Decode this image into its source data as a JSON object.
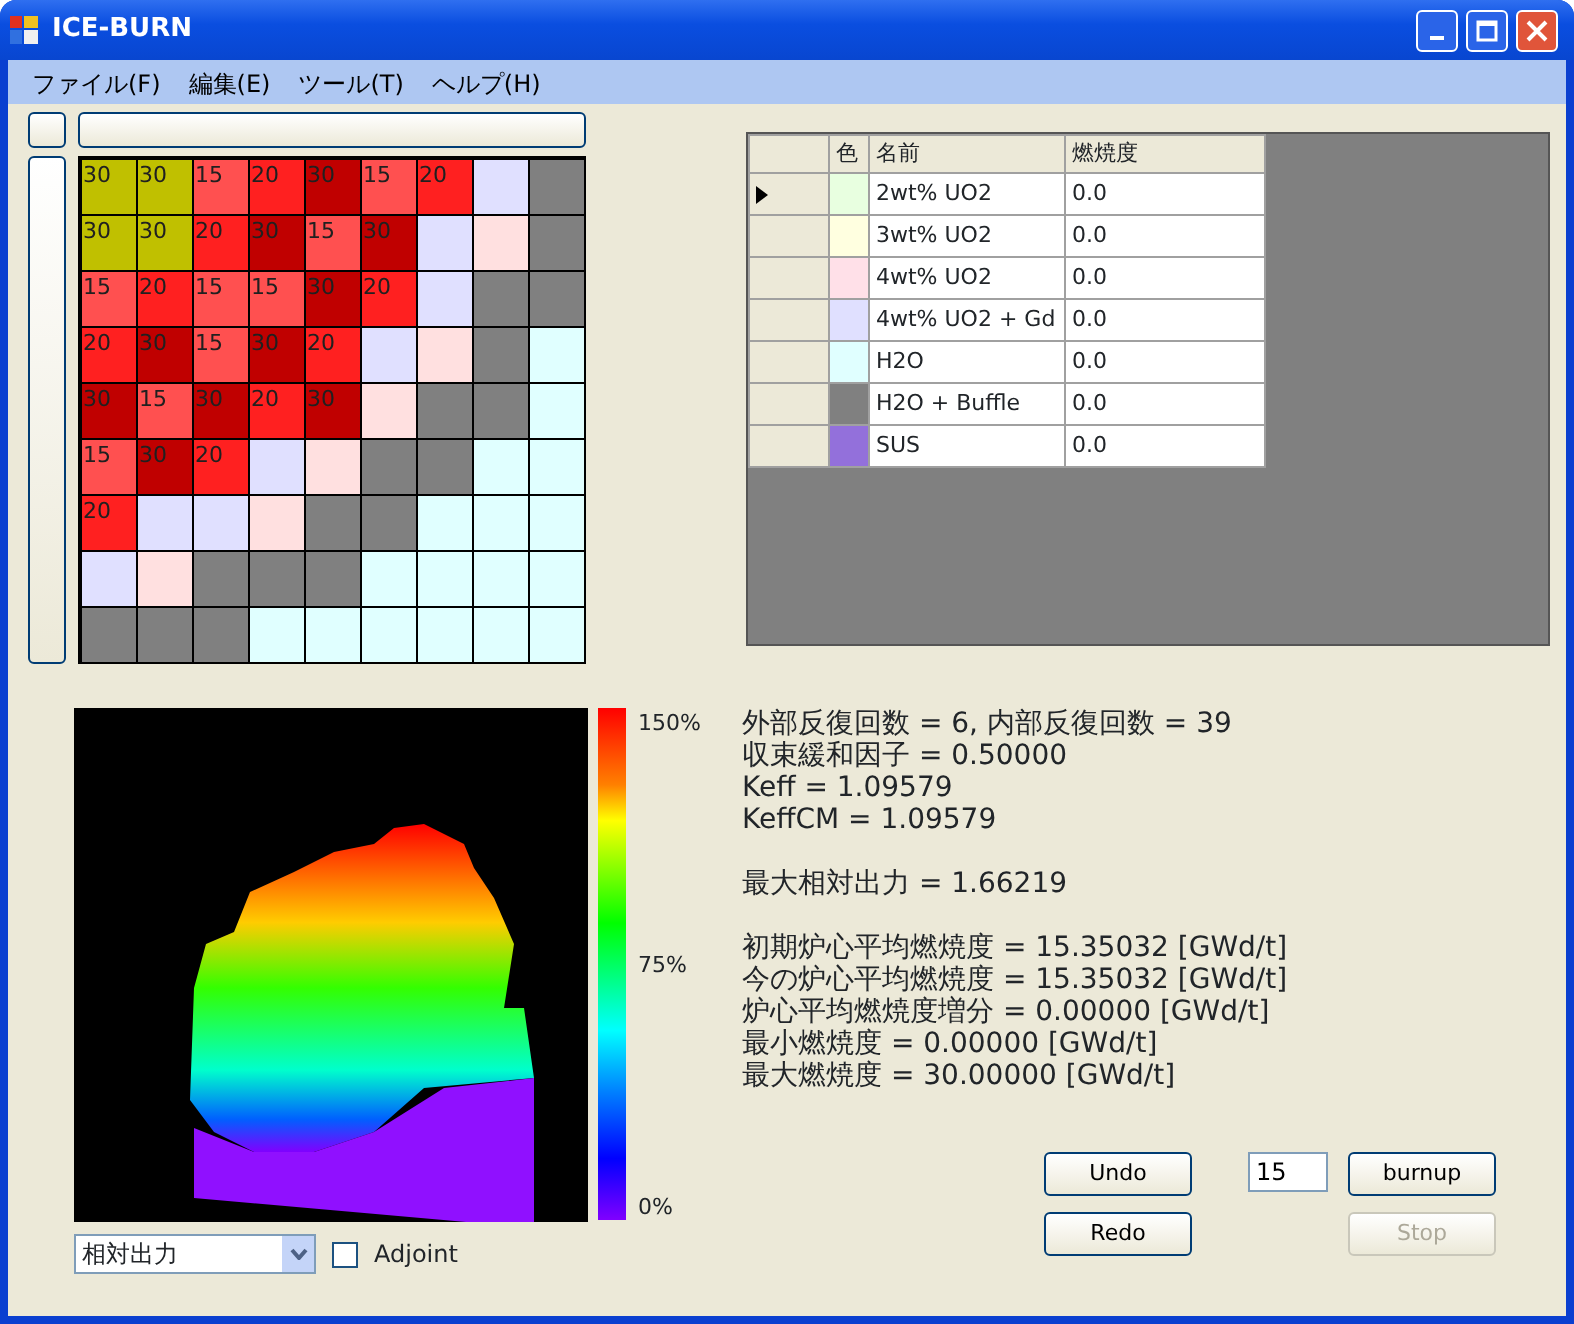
{
  "window": {
    "title": "ICE-BURN"
  },
  "menu": [
    "ファイル(F)",
    "編集(E)",
    "ツール(T)",
    "ヘルプ(H)"
  ],
  "grid": [
    [
      {
        "label": "30",
        "color": "#c0c000"
      },
      {
        "label": "30",
        "color": "#c0c000"
      },
      {
        "label": "15",
        "color": "#ff5050"
      },
      {
        "label": "20",
        "color": "#ff2020"
      },
      {
        "label": "30",
        "color": "#c00000"
      },
      {
        "label": "15",
        "color": "#ff5050"
      },
      {
        "label": "20",
        "color": "#ff2020"
      },
      {
        "color": "#e0e0ff"
      },
      {
        "color": "#808080"
      }
    ],
    [
      {
        "label": "30",
        "color": "#c0c000"
      },
      {
        "label": "30",
        "color": "#c0c000"
      },
      {
        "label": "20",
        "color": "#ff2020"
      },
      {
        "label": "30",
        "color": "#c00000"
      },
      {
        "label": "15",
        "color": "#ff5050"
      },
      {
        "label": "30",
        "color": "#c00000"
      },
      {
        "color": "#e0e0ff"
      },
      {
        "color": "#ffe0e0"
      },
      {
        "color": "#808080"
      }
    ],
    [
      {
        "label": "15",
        "color": "#ff5050"
      },
      {
        "label": "20",
        "color": "#ff2020"
      },
      {
        "label": "15",
        "color": "#ff5050"
      },
      {
        "label": "15",
        "color": "#ff5050"
      },
      {
        "label": "30",
        "color": "#c00000"
      },
      {
        "label": "20",
        "color": "#ff2020"
      },
      {
        "color": "#e0e0ff"
      },
      {
        "color": "#808080"
      },
      {
        "color": "#808080"
      }
    ],
    [
      {
        "label": "20",
        "color": "#ff2020"
      },
      {
        "label": "30",
        "color": "#c00000"
      },
      {
        "label": "15",
        "color": "#ff5050"
      },
      {
        "label": "30",
        "color": "#c00000"
      },
      {
        "label": "20",
        "color": "#ff2020"
      },
      {
        "color": "#e0e0ff"
      },
      {
        "color": "#ffe0e0"
      },
      {
        "color": "#808080"
      },
      {
        "color": "#e0ffff"
      }
    ],
    [
      {
        "label": "30",
        "color": "#c00000"
      },
      {
        "label": "15",
        "color": "#ff5050"
      },
      {
        "label": "30",
        "color": "#c00000"
      },
      {
        "label": "20",
        "color": "#ff2020"
      },
      {
        "label": "30",
        "color": "#c00000"
      },
      {
        "color": "#ffe0e0"
      },
      {
        "color": "#808080"
      },
      {
        "color": "#808080"
      },
      {
        "color": "#e0ffff"
      }
    ],
    [
      {
        "label": "15",
        "color": "#ff5050"
      },
      {
        "label": "30",
        "color": "#c00000"
      },
      {
        "label": "20",
        "color": "#ff2020"
      },
      {
        "color": "#e0e0ff"
      },
      {
        "color": "#ffe0e0"
      },
      {
        "color": "#808080"
      },
      {
        "color": "#808080"
      },
      {
        "color": "#e0ffff"
      },
      {
        "color": "#e0ffff"
      }
    ],
    [
      {
        "label": "20",
        "color": "#ff2020"
      },
      {
        "color": "#e0e0ff"
      },
      {
        "color": "#e0e0ff"
      },
      {
        "color": "#ffe0e0"
      },
      {
        "color": "#808080"
      },
      {
        "color": "#808080"
      },
      {
        "color": "#e0ffff"
      },
      {
        "color": "#e0ffff"
      },
      {
        "color": "#e0ffff"
      }
    ],
    [
      {
        "color": "#e0e0ff"
      },
      {
        "color": "#ffe0e0"
      },
      {
        "color": "#808080"
      },
      {
        "color": "#808080"
      },
      {
        "color": "#808080"
      },
      {
        "color": "#e0ffff"
      },
      {
        "color": "#e0ffff"
      },
      {
        "color": "#e0ffff"
      },
      {
        "color": "#e0ffff"
      }
    ],
    [
      {
        "color": "#808080"
      },
      {
        "color": "#808080"
      },
      {
        "color": "#808080"
      },
      {
        "color": "#e0ffff"
      },
      {
        "color": "#e0ffff"
      },
      {
        "color": "#e0ffff"
      },
      {
        "color": "#e0ffff"
      },
      {
        "color": "#e0ffff"
      },
      {
        "color": "#e0ffff"
      }
    ]
  ],
  "materials": {
    "columns": [
      "色",
      "名前",
      "燃焼度"
    ],
    "rows": [
      {
        "color": "#e8ffe0",
        "name": "2wt% UO2",
        "burnup": "0.0",
        "selected": true
      },
      {
        "color": "#ffffe0",
        "name": "3wt% UO2",
        "burnup": "0.0",
        "selected": false
      },
      {
        "color": "#ffe0e8",
        "name": "4wt% UO2",
        "burnup": "0.0",
        "selected": false
      },
      {
        "color": "#e0e0ff",
        "name": "4wt% UO2 + Gd",
        "burnup": "0.0",
        "selected": false
      },
      {
        "color": "#e0ffff",
        "name": "H2O",
        "burnup": "0.0",
        "selected": false
      },
      {
        "color": "#808080",
        "name": "H2O + Buffle",
        "burnup": "0.0",
        "selected": false
      },
      {
        "color": "#9370db",
        "name": "SUS",
        "burnup": "0.0",
        "selected": false
      }
    ]
  },
  "colorbar": {
    "labels": [
      "150%",
      "75%",
      "0%"
    ]
  },
  "results": [
    [
      "外部反復回数 = 6, 内部反復回数 = 39",
      "収束緩和因子 = 0.50000",
      "Keff = 1.09579",
      "KeffCM = 1.09579"
    ],
    [
      "最大相対出力 = 1.66219"
    ],
    [
      "初期炉心平均燃焼度 = 15.35032 [GWd/t]",
      "今の炉心平均燃焼度 = 15.35032 [GWd/t]",
      "炉心平均燃焼度増分 = 0.00000 [GWd/t]",
      "最小燃焼度 = 0.00000 [GWd/t]",
      "最大燃焼度 = 30.00000 [GWd/t]"
    ]
  ],
  "view_select": {
    "value": "相対出力"
  },
  "adjoint": {
    "label": "Adjoint",
    "checked": false
  },
  "buttons": {
    "undo": {
      "label": "Undo",
      "disabled": false
    },
    "redo": {
      "label": "Redo",
      "disabled": false
    },
    "burnup": {
      "label": "burnup",
      "disabled": false
    },
    "stop": {
      "label": "Stop",
      "disabled": true
    }
  },
  "step_input": {
    "value": "15"
  }
}
